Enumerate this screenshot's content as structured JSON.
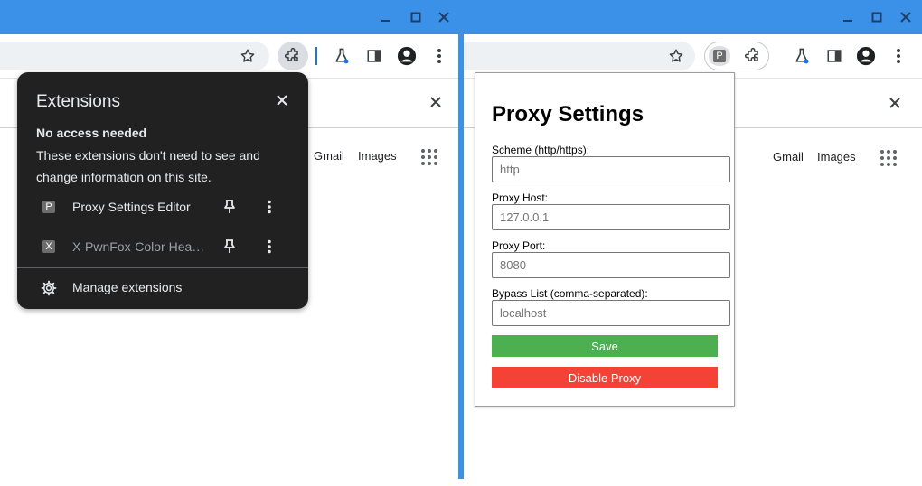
{
  "colors": {
    "titlebar": "#3b91e8",
    "popup_bg": "#212121",
    "save_button": "#4caf50",
    "disable_button": "#f44336"
  },
  "left_window": {
    "google_links": [
      "Gmail",
      "Images"
    ],
    "extensions_popup": {
      "title": "Extensions",
      "section_heading": "No access needed",
      "section_description": "These extensions don't need to see and change information on this site.",
      "items": [
        {
          "badge": "P",
          "name": "Proxy Settings Editor",
          "icon": "proxy-extension-icon"
        },
        {
          "badge": "X",
          "name": "X-PwnFox-Color Header",
          "icon": "pwnfox-extension-icon"
        }
      ],
      "manage_label": "Manage extensions"
    }
  },
  "right_window": {
    "extension_badge": "P",
    "google_links": [
      "Gmail",
      "Images"
    ],
    "proxy_popup": {
      "title": "Proxy Settings",
      "scheme_label": "Scheme (http/https):",
      "scheme_placeholder": "http",
      "host_label": "Proxy Host:",
      "host_placeholder": "127.0.0.1",
      "port_label": "Proxy Port:",
      "port_placeholder": "8080",
      "bypass_label": "Bypass List (comma-separated):",
      "bypass_placeholder": "localhost",
      "save_label": "Save",
      "disable_label": "Disable Proxy"
    }
  }
}
